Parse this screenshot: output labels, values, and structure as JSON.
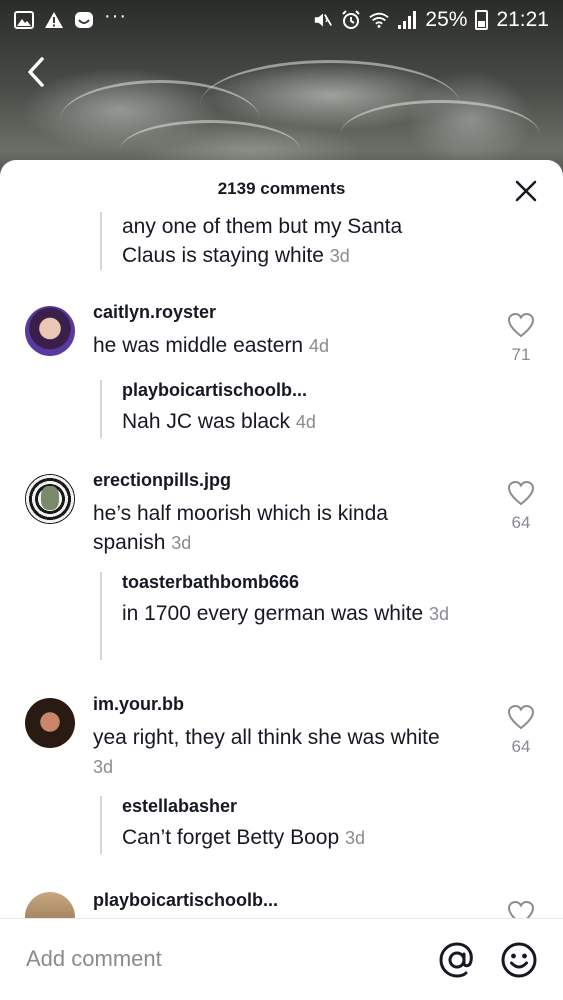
{
  "status_bar": {
    "battery": "25%",
    "time": "21:21",
    "left_icons": [
      "image-icon",
      "warning-icon",
      "app-icon",
      "more-dots-icon"
    ],
    "right_icons": [
      "mute-icon",
      "alarm-icon",
      "wifi-icon",
      "signal-icon",
      "battery-icon"
    ]
  },
  "header": {
    "comment_count": "2139 comments"
  },
  "partial_reply": {
    "text": "any one of them but my Santa Claus is staying white",
    "age": "3d"
  },
  "comments": [
    {
      "username": "caitlyn.royster",
      "text": "he was middle eastern",
      "age": "4d",
      "likes": "71",
      "reply": {
        "username": "playboicartischoolb...",
        "text": "Nah JC was black",
        "age": "4d"
      }
    },
    {
      "username": "erectionpills.jpg",
      "text": "he’s half moorish which is kinda spanish",
      "age": "3d",
      "likes": "64",
      "reply": {
        "username": "toasterbathbomb666",
        "text": "in 1700 every german was white",
        "age": "3d"
      }
    },
    {
      "username": "im.your.bb",
      "text": "yea right, they all think she was white",
      "age": "3d",
      "likes": "64",
      "reply": {
        "username": "estellabasher",
        "text": "Can’t forget Betty Boop",
        "age": "3d"
      }
    },
    {
      "username": "playboicartischoolb..."
    }
  ],
  "composer": {
    "placeholder": "Add comment"
  },
  "colors": {
    "text": "#161823",
    "secondary": "#8a8b91",
    "divider": "#d6d6d6"
  }
}
